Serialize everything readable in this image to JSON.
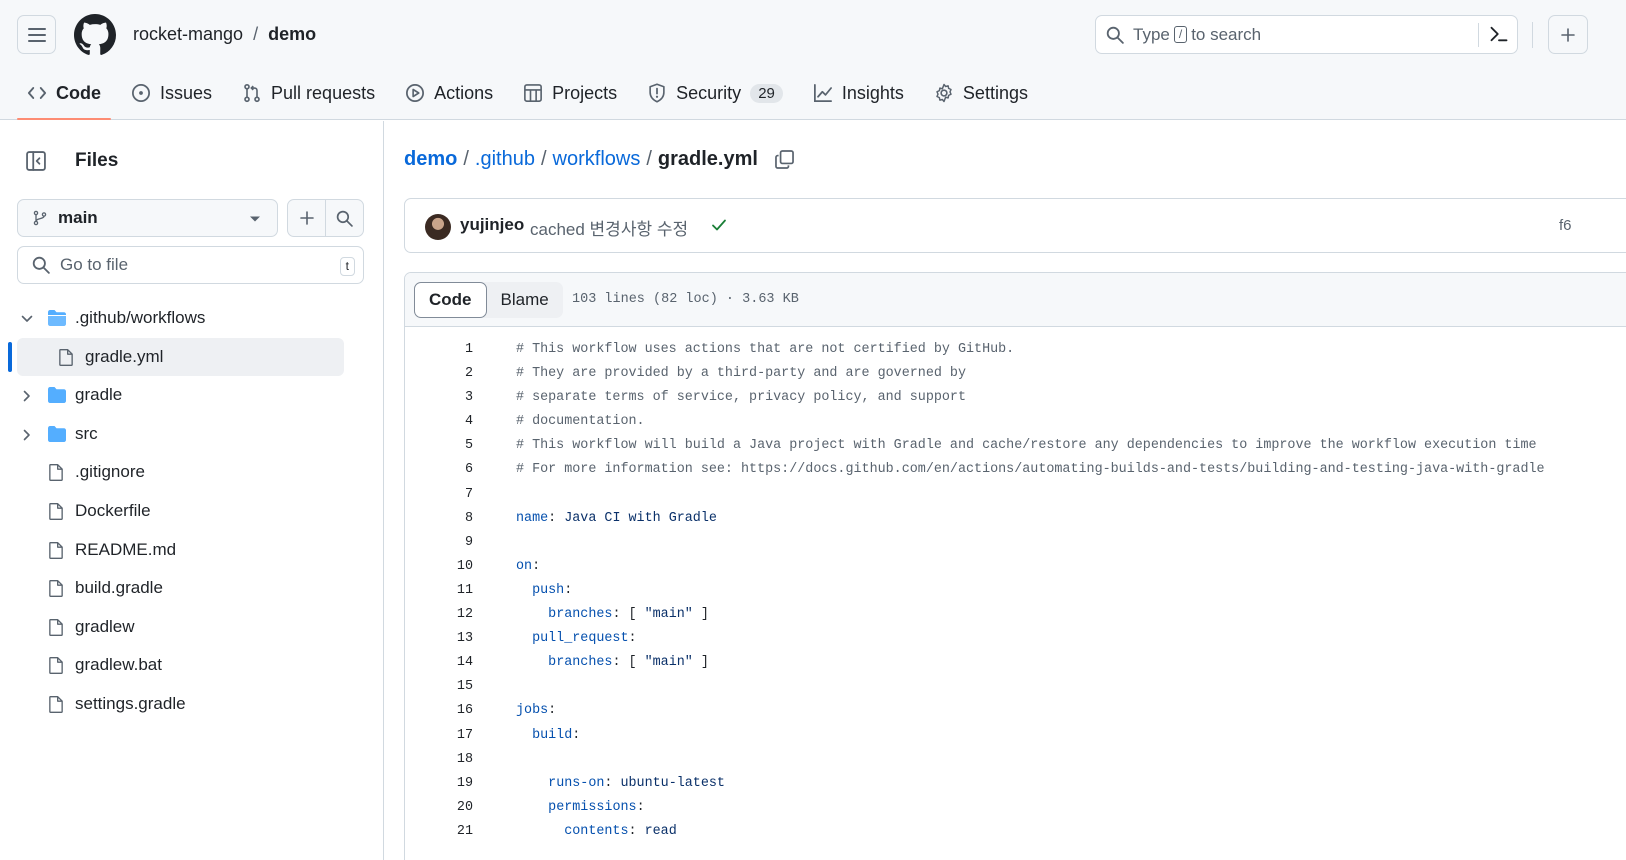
{
  "header": {
    "owner": "rocket-mango",
    "separator": "/",
    "repo": "demo",
    "search": {
      "prefix": "Type",
      "key": "/",
      "suffix": "to search"
    }
  },
  "nav": {
    "items": [
      {
        "label": "Code",
        "icon": "code-icon",
        "active": true
      },
      {
        "label": "Issues",
        "icon": "issue-icon"
      },
      {
        "label": "Pull requests",
        "icon": "pull-request-icon"
      },
      {
        "label": "Actions",
        "icon": "play-icon"
      },
      {
        "label": "Projects",
        "icon": "table-icon"
      },
      {
        "label": "Security",
        "icon": "shield-icon",
        "count": "29"
      },
      {
        "label": "Insights",
        "icon": "graph-icon"
      },
      {
        "label": "Settings",
        "icon": "gear-icon"
      }
    ]
  },
  "sidebar": {
    "title": "Files",
    "branch": "main",
    "goto_placeholder": "Go to file",
    "goto_key": "t",
    "tree": [
      {
        "label": ".github/workflows",
        "type": "folder-open",
        "expanded": true,
        "depth": 0
      },
      {
        "label": "gradle.yml",
        "type": "file",
        "depth": 1,
        "selected": true
      },
      {
        "label": "gradle",
        "type": "folder",
        "depth": 0
      },
      {
        "label": "src",
        "type": "folder",
        "depth": 0
      },
      {
        "label": ".gitignore",
        "type": "file",
        "depth": 0
      },
      {
        "label": "Dockerfile",
        "type": "file",
        "depth": 0
      },
      {
        "label": "README.md",
        "type": "file",
        "depth": 0
      },
      {
        "label": "build.gradle",
        "type": "file",
        "depth": 0
      },
      {
        "label": "gradlew",
        "type": "file",
        "depth": 0
      },
      {
        "label": "gradlew.bat",
        "type": "file",
        "depth": 0
      },
      {
        "label": "settings.gradle",
        "type": "file",
        "depth": 0
      }
    ]
  },
  "breadcrumb": {
    "root": "demo",
    "parts": [
      ".github",
      "workflows"
    ],
    "current": "gradle.yml",
    "sep": "/"
  },
  "commit": {
    "author": "yujinjeo",
    "message": "cached 변경사항 수정",
    "hash_partial": "f6"
  },
  "file": {
    "tabs": [
      "Code",
      "Blame"
    ],
    "active_tab": "Code",
    "meta": "103 lines (82 loc) · 3.63 KB",
    "lines": [
      {
        "n": "1",
        "parts": [
          {
            "t": "# This workflow uses actions that are not certified by GitHub.",
            "c": "comment"
          }
        ]
      },
      {
        "n": "2",
        "parts": [
          {
            "t": "# They are provided by a third-party and are governed by",
            "c": "comment"
          }
        ]
      },
      {
        "n": "3",
        "parts": [
          {
            "t": "# separate terms of service, privacy policy, and support",
            "c": "comment"
          }
        ]
      },
      {
        "n": "4",
        "parts": [
          {
            "t": "# documentation.",
            "c": "comment"
          }
        ]
      },
      {
        "n": "5",
        "parts": [
          {
            "t": "# This workflow will build a Java project with Gradle and cache/restore any dependencies to improve the workflow execution time",
            "c": "comment"
          }
        ]
      },
      {
        "n": "6",
        "parts": [
          {
            "t": "# For more information see: https://docs.github.com/en/actions/automating-builds-and-tests/building-and-testing-java-with-gradle",
            "c": "comment"
          }
        ]
      },
      {
        "n": "7",
        "parts": []
      },
      {
        "n": "8",
        "parts": [
          {
            "t": "name",
            "c": "key"
          },
          {
            "t": ": ",
            "c": ""
          },
          {
            "t": "Java CI with Gradle",
            "c": "str"
          }
        ]
      },
      {
        "n": "9",
        "parts": []
      },
      {
        "n": "10",
        "parts": [
          {
            "t": "on",
            "c": "key"
          },
          {
            "t": ":",
            "c": ""
          }
        ]
      },
      {
        "n": "11",
        "parts": [
          {
            "t": "  ",
            "c": ""
          },
          {
            "t": "push",
            "c": "key"
          },
          {
            "t": ":",
            "c": ""
          }
        ]
      },
      {
        "n": "12",
        "parts": [
          {
            "t": "    ",
            "c": ""
          },
          {
            "t": "branches",
            "c": "key"
          },
          {
            "t": ": [ ",
            "c": ""
          },
          {
            "t": "\"main\"",
            "c": "str"
          },
          {
            "t": " ]",
            "c": ""
          }
        ]
      },
      {
        "n": "13",
        "parts": [
          {
            "t": "  ",
            "c": ""
          },
          {
            "t": "pull_request",
            "c": "key"
          },
          {
            "t": ":",
            "c": ""
          }
        ]
      },
      {
        "n": "14",
        "parts": [
          {
            "t": "    ",
            "c": ""
          },
          {
            "t": "branches",
            "c": "key"
          },
          {
            "t": ": [ ",
            "c": ""
          },
          {
            "t": "\"main\"",
            "c": "str"
          },
          {
            "t": " ]",
            "c": ""
          }
        ]
      },
      {
        "n": "15",
        "parts": []
      },
      {
        "n": "16",
        "parts": [
          {
            "t": "jobs",
            "c": "key"
          },
          {
            "t": ":",
            "c": ""
          }
        ]
      },
      {
        "n": "17",
        "parts": [
          {
            "t": "  ",
            "c": ""
          },
          {
            "t": "build",
            "c": "key"
          },
          {
            "t": ":",
            "c": ""
          }
        ]
      },
      {
        "n": "18",
        "parts": []
      },
      {
        "n": "19",
        "parts": [
          {
            "t": "    ",
            "c": ""
          },
          {
            "t": "runs-on",
            "c": "key"
          },
          {
            "t": ": ",
            "c": ""
          },
          {
            "t": "ubuntu-latest",
            "c": "str"
          }
        ]
      },
      {
        "n": "20",
        "parts": [
          {
            "t": "    ",
            "c": ""
          },
          {
            "t": "permissions",
            "c": "key"
          },
          {
            "t": ":",
            "c": ""
          }
        ]
      },
      {
        "n": "21",
        "parts": [
          {
            "t": "      ",
            "c": ""
          },
          {
            "t": "contents",
            "c": "key"
          },
          {
            "t": ": ",
            "c": ""
          },
          {
            "t": "read",
            "c": "str"
          }
        ]
      }
    ]
  },
  "colors": {
    "accent": "#0969da",
    "active_underline": "#fd8c73",
    "folder": "#54aeff"
  }
}
